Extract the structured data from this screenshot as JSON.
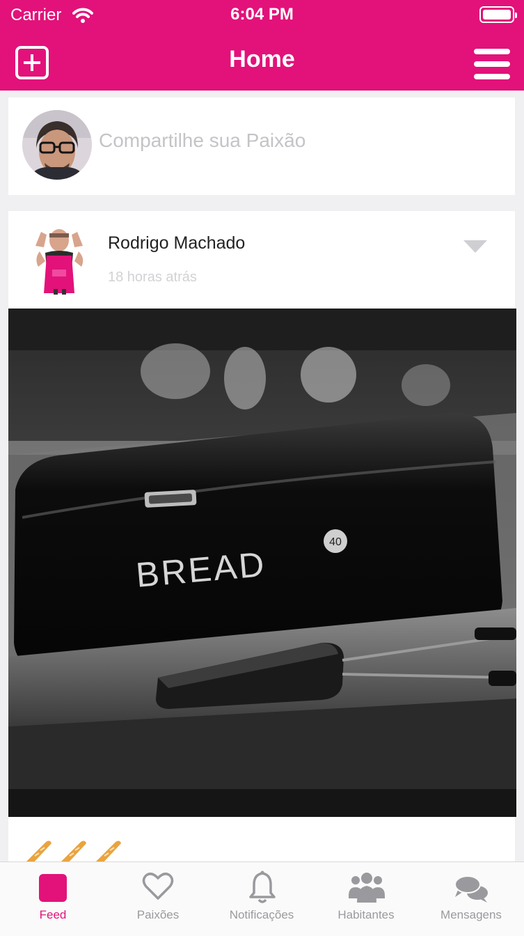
{
  "status_bar": {
    "carrier": "Carrier",
    "time": "6:04 PM"
  },
  "nav": {
    "title": "Home",
    "left_icon": "add-square-icon",
    "right_icon": "hamburger-menu-icon"
  },
  "composer": {
    "placeholder": "Compartilhe sua Paixão"
  },
  "post": {
    "author": "Rodrigo Machado",
    "time_ago": "18 horas atrás",
    "image_text": "BREAD",
    "image_badge": "40",
    "reaction_icon": "baguette-icon"
  },
  "tabs": [
    {
      "label": "Feed",
      "icon": "feed-square-icon",
      "active": true
    },
    {
      "label": "Paixões",
      "icon": "heart-icon",
      "active": false
    },
    {
      "label": "Notificações",
      "icon": "bell-icon",
      "active": false
    },
    {
      "label": "Habitantes",
      "icon": "people-icon",
      "active": false
    },
    {
      "label": "Mensagens",
      "icon": "chat-bubbles-icon",
      "active": false
    }
  ],
  "colors": {
    "brand": "#e2127a",
    "tab_inactive": "#9a9a9e",
    "placeholder": "#c4c4c8"
  }
}
